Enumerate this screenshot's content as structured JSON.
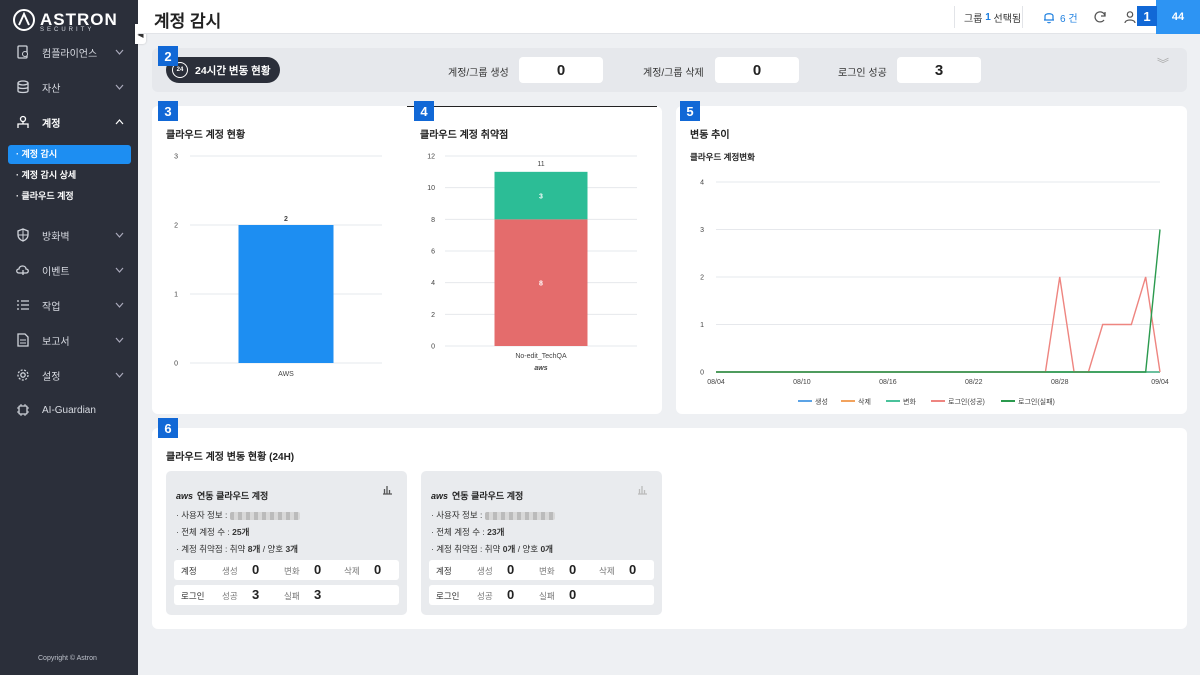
{
  "sidebar": {
    "brand": "ASTRON",
    "brand_sub": "SECURITY",
    "items": [
      {
        "label": "컴플라이언스"
      },
      {
        "label": "자산"
      },
      {
        "label": "계정"
      },
      {
        "label": "방화벽"
      },
      {
        "label": "이벤트"
      },
      {
        "label": "작업"
      },
      {
        "label": "보고서"
      },
      {
        "label": "설정"
      },
      {
        "label": "AI-Guardian"
      }
    ],
    "subitems": [
      {
        "label": "· 계정 감시",
        "active": true
      },
      {
        "label": "· 계정 감시 상세",
        "active": false
      },
      {
        "label": "· 클라우드 계정",
        "active": false
      }
    ],
    "copyright": "Copyright © Astron"
  },
  "header": {
    "title": "계정 감시",
    "group_prefix": "그룹",
    "group_count": "1",
    "group_suffix": "선택됨",
    "alerts": "6 건",
    "user_badge": "44"
  },
  "annotations": [
    "1",
    "2",
    "3",
    "4",
    "5",
    "6"
  ],
  "summary": {
    "badge": "24시간 변동 현황",
    "clock": "24",
    "stats": [
      {
        "label": "계정/그룹 생성",
        "value": "0"
      },
      {
        "label": "계정/그룹 삭제",
        "value": "0"
      },
      {
        "label": "로그인 성공",
        "value": "3"
      }
    ]
  },
  "cloud_status": {
    "title": "클라우드 계정 현황",
    "chart_data": {
      "type": "bar",
      "categories": [
        "AWS"
      ],
      "values": [
        2
      ],
      "ylim": [
        0,
        3
      ],
      "yticks": [
        0,
        1,
        2,
        3
      ],
      "color": "#1d8ef2"
    }
  },
  "cloud_vuln": {
    "title": "클라우드 계정 취약점",
    "chart_data": {
      "type": "bar",
      "stacked": true,
      "categories": [
        "No-edit_TechQA"
      ],
      "series": [
        {
          "values": [
            8
          ],
          "color": "#e46c6c"
        },
        {
          "values": [
            3
          ],
          "color": "#2cbd96"
        }
      ],
      "total_labels": [
        "11"
      ],
      "ylim": [
        0,
        12
      ],
      "yticks": [
        0,
        2,
        4,
        6,
        8,
        10,
        12
      ],
      "category_logo": "aws"
    }
  },
  "trend": {
    "title": "변동 추이",
    "subtitle": "클라우드 계정변화",
    "chart_data": {
      "type": "line",
      "x": [
        "08/04",
        "08/05",
        "08/06",
        "08/07",
        "08/08",
        "08/09",
        "08/10",
        "08/11",
        "08/12",
        "08/13",
        "08/14",
        "08/15",
        "08/16",
        "08/17",
        "08/18",
        "08/19",
        "08/20",
        "08/21",
        "08/22",
        "08/23",
        "08/24",
        "08/25",
        "08/26",
        "08/27",
        "08/28",
        "08/29",
        "08/30",
        "08/31",
        "09/01",
        "09/02",
        "09/03",
        "09/04"
      ],
      "xticks": [
        "08/04",
        "08/10",
        "08/16",
        "08/22",
        "08/28",
        "09/04"
      ],
      "ylim": [
        0,
        4
      ],
      "yticks": [
        0,
        1,
        2,
        3,
        4
      ],
      "series": [
        {
          "name": "생성",
          "color": "#5ba3e6",
          "values": [
            0,
            0,
            0,
            0,
            0,
            0,
            0,
            0,
            0,
            0,
            0,
            0,
            0,
            0,
            0,
            0,
            0,
            0,
            0,
            0,
            0,
            0,
            0,
            0,
            0,
            0,
            0,
            0,
            0,
            0,
            0,
            0
          ]
        },
        {
          "name": "삭제",
          "color": "#f2a35e",
          "values": [
            0,
            0,
            0,
            0,
            0,
            0,
            0,
            0,
            0,
            0,
            0,
            0,
            0,
            0,
            0,
            0,
            0,
            0,
            0,
            0,
            0,
            0,
            0,
            0,
            0,
            0,
            0,
            0,
            0,
            0,
            0,
            0
          ]
        },
        {
          "name": "변화",
          "color": "#4ac29b",
          "values": [
            0,
            0,
            0,
            0,
            0,
            0,
            0,
            0,
            0,
            0,
            0,
            0,
            0,
            0,
            0,
            0,
            0,
            0,
            0,
            0,
            0,
            0,
            0,
            0,
            0,
            0,
            0,
            0,
            0,
            0,
            0,
            0
          ]
        },
        {
          "name": "로그인(성공)",
          "color": "#ee8580",
          "values": [
            0,
            0,
            0,
            0,
            0,
            0,
            0,
            0,
            0,
            0,
            0,
            0,
            0,
            0,
            0,
            0,
            0,
            0,
            0,
            0,
            0,
            0,
            0,
            0,
            2,
            0,
            0,
            1,
            1,
            1,
            2,
            0
          ]
        },
        {
          "name": "로그인(실패)",
          "color": "#2b9a4e",
          "values": [
            0,
            0,
            0,
            0,
            0,
            0,
            0,
            0,
            0,
            0,
            0,
            0,
            0,
            0,
            0,
            0,
            0,
            0,
            0,
            0,
            0,
            0,
            0,
            0,
            0,
            0,
            0,
            0,
            0,
            0,
            0,
            3
          ]
        }
      ]
    }
  },
  "changes": {
    "title": "클라우드 계정 변동 현황 (24H)",
    "cards": [
      {
        "logo": "aws",
        "title": "연동 클라우드 계정",
        "user_info_label": "· 사용자 정보 :",
        "total_label": "· 전체 계정 수 :",
        "total_value": "25개",
        "vuln_label": "· 계정 취약점 : 취약",
        "vuln_value": "8개",
        "good_label": "/ 양호",
        "good_value": "3개",
        "acct_label": "계정",
        "create_label": "생성",
        "create_value": "0",
        "change_label": "변화",
        "change_value": "0",
        "delete_label": "삭제",
        "delete_value": "0",
        "login_label": "로그인",
        "success_label": "성공",
        "success_value": "3",
        "fail_label": "실패",
        "fail_value": "3"
      },
      {
        "logo": "aws",
        "title": "연동 클라우드 계정",
        "user_info_label": "· 사용자 정보 :",
        "total_label": "· 전체 계정 수 :",
        "total_value": "23개",
        "vuln_label": "· 계정 취약점 : 취약",
        "vuln_value": "0개",
        "good_label": "/ 양호",
        "good_value": "0개",
        "acct_label": "계정",
        "create_label": "생성",
        "create_value": "0",
        "change_label": "변화",
        "change_value": "0",
        "delete_label": "삭제",
        "delete_value": "0",
        "login_label": "로그인",
        "success_label": "성공",
        "success_value": "0",
        "fail_label": "실패",
        "fail_value": "0"
      }
    ]
  }
}
